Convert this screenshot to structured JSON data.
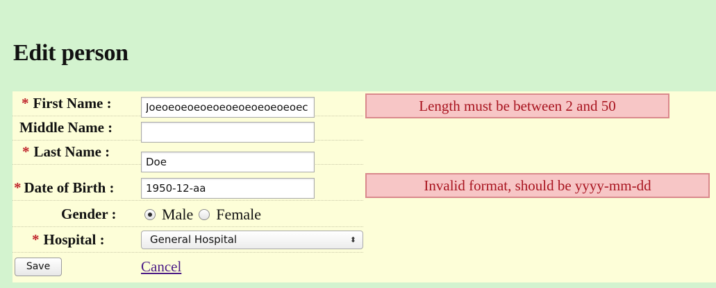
{
  "page": {
    "title": "Edit person",
    "background_color": "#d3f3cf",
    "form_background_color": "#fdfed8"
  },
  "fields": {
    "first_name": {
      "required_mark": "*",
      "label": "First Name :",
      "value": "Joeoeoeoeoeoeoeoeoeoeoeoec",
      "error": "Length must be between 2 and 50"
    },
    "middle_name": {
      "label": "Middle Name :",
      "value": ""
    },
    "last_name": {
      "required_mark": "*",
      "label": "Last Name :",
      "value": "Doe"
    },
    "date_of_birth": {
      "required_mark": "*",
      "label": "Date of Birth :",
      "value": "1950-12-aa",
      "error": "Invalid format, should be yyyy-mm-dd"
    },
    "gender": {
      "label": "Gender :",
      "options": [
        "Male",
        "Female"
      ],
      "selected": "Male"
    },
    "hospital": {
      "required_mark": "*",
      "label": "Hospital :",
      "selected": "General Hospital",
      "arrow_glyph": "⬍"
    }
  },
  "actions": {
    "save_label": "Save",
    "cancel_label": "Cancel"
  },
  "colors": {
    "required_mark": "#c0272d",
    "error_background": "#f7c6c6",
    "error_border": "#d9888c",
    "error_text": "#a8141f",
    "link": "#4b1a86"
  }
}
